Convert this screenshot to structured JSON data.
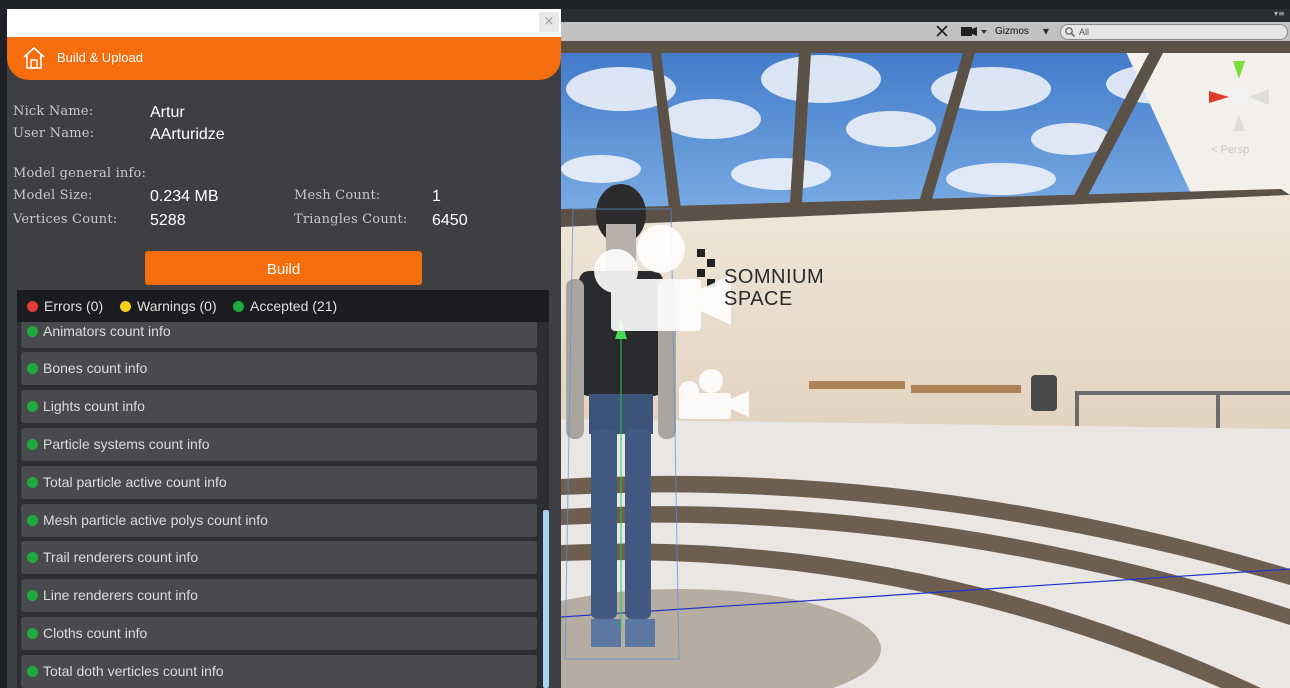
{
  "panel": {
    "close_glyph": "×",
    "header_title": "Build & Upload",
    "header_icon": "home-icon"
  },
  "user": {
    "nick_label": "Nick Name:",
    "nick_value": "Artur",
    "user_label": "User Name:",
    "user_value": "AArturidze"
  },
  "model": {
    "section_label": "Model general info:",
    "size_label": "Model Size:",
    "size_value": "0.234 MB",
    "mesh_label": "Mesh Count:",
    "mesh_value": "1",
    "vertices_label": "Vertices Count:",
    "vertices_value": "5288",
    "triangles_label": "Triangles Count:",
    "triangles_value": "6450"
  },
  "build_label": "Build",
  "filters": {
    "errors": "Errors (0)",
    "warnings": "Warnings (0)",
    "accepted": "Accepted (21)"
  },
  "colors": {
    "accent": "#f56d0c",
    "error": "#e53935",
    "warning": "#f2d21b",
    "accepted": "#1faa3c"
  },
  "items": [
    "Animators count info",
    "Bones count info",
    "Lights count info",
    "Particle systems count info",
    "Total particle active count info",
    "Mesh particle active polys count info",
    "Trail renderers count info",
    "Line renderers count info",
    "Cloths count info",
    "Total doth verticles count info"
  ],
  "scene": {
    "gizmos_label": "Gizmos",
    "search_placeholder": "All",
    "persp_label": "< Persp",
    "logo_line1": "SOMNIUM",
    "logo_line2": "SPACE"
  }
}
